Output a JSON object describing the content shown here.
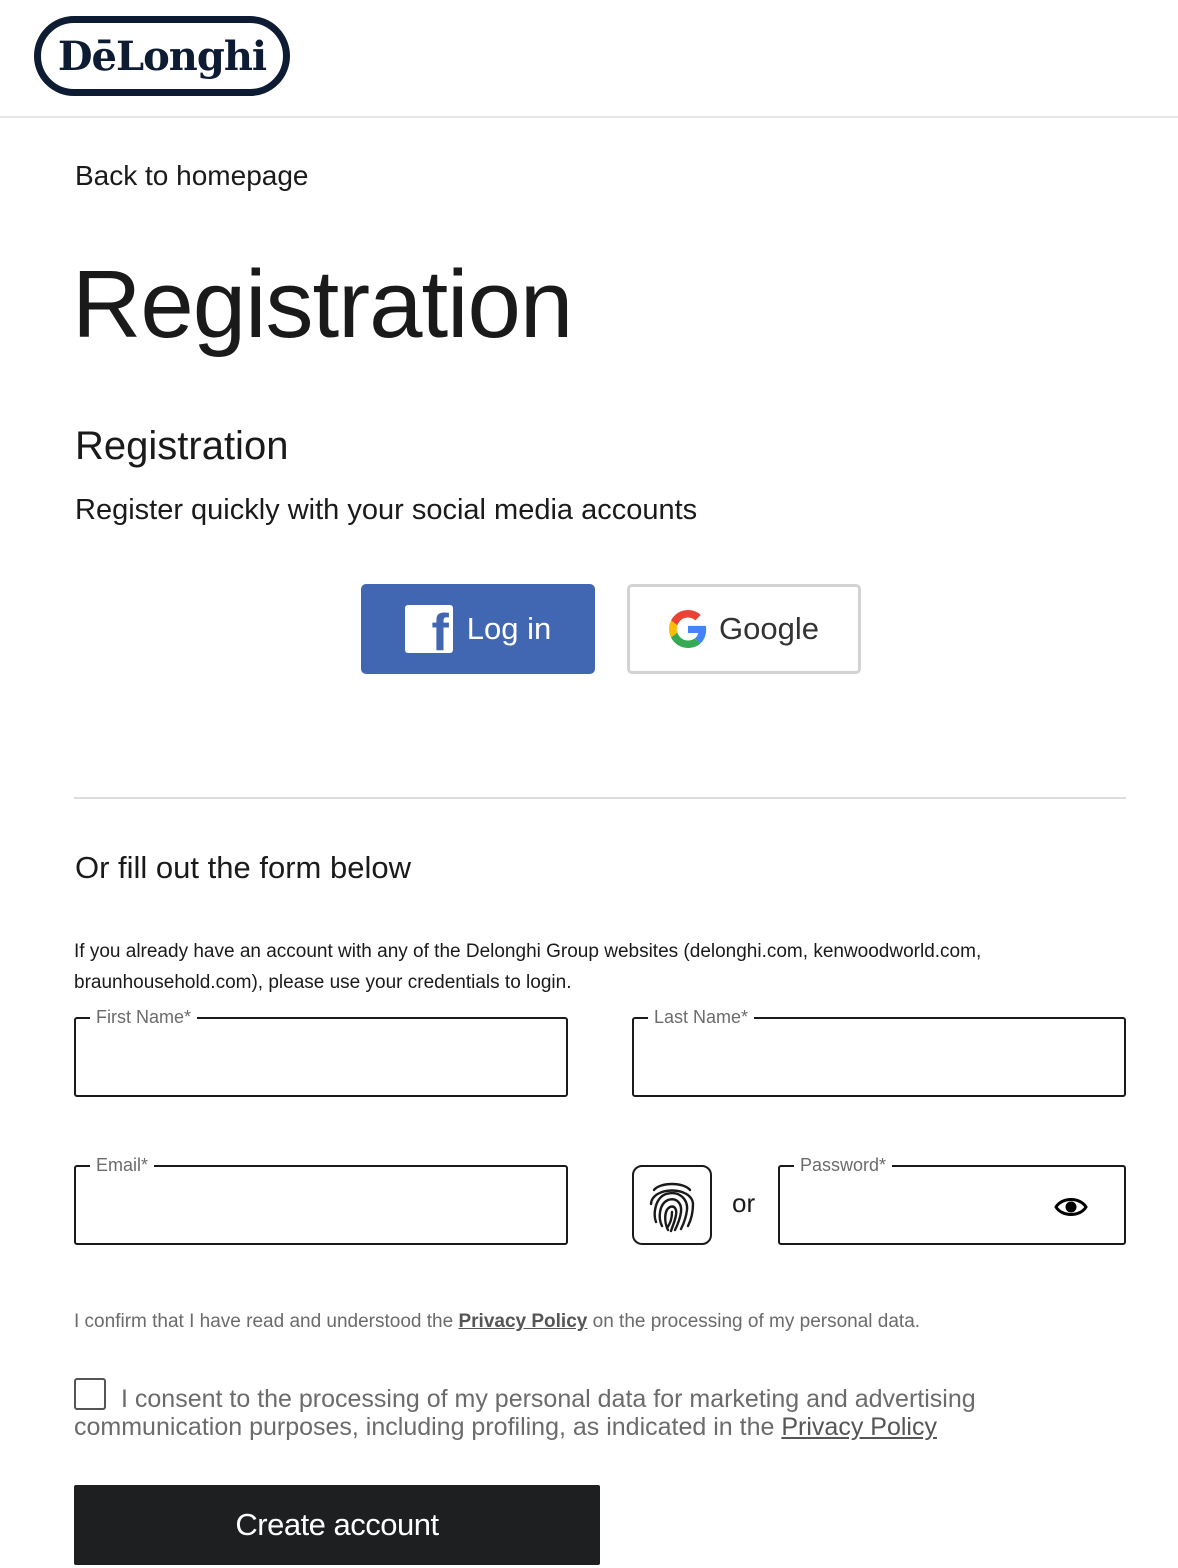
{
  "header": {
    "logo_text": "DēLonghi"
  },
  "nav": {
    "back_label": "Back to homepage"
  },
  "page": {
    "title": "Registration"
  },
  "social": {
    "title": "Registration",
    "subtitle": "Register quickly with your social media accounts",
    "facebook_label": "Log in",
    "google_label": "Google",
    "facebook_color": "#4267b2"
  },
  "form": {
    "title": "Or fill out the form below",
    "info": "If you already have an account with any of the Delonghi Group websites (delonghi.com, kenwoodworld.com, braunhousehold.com), please use your credentials to login.",
    "first_name_label": "First Name*",
    "last_name_label": "Last Name*",
    "email_label": "Email*",
    "password_label": "Password*",
    "or_label": "or",
    "privacy_prefix": "I confirm that I have read and understood the",
    "privacy_link": "Privacy Policy",
    "privacy_suffix": "on the processing of my personal data.",
    "consent_text": "I consent to the processing of my personal data for marketing and advertising communication purposes, including profiling, as indicated in the",
    "consent_link": "Privacy Policy",
    "submit_label": "Create account"
  },
  "icons": {
    "logo": "delonghi-logo",
    "facebook": "facebook-icon",
    "google": "google-icon",
    "fingerprint": "fingerprint-icon",
    "password_toggle": "eye-icon"
  }
}
